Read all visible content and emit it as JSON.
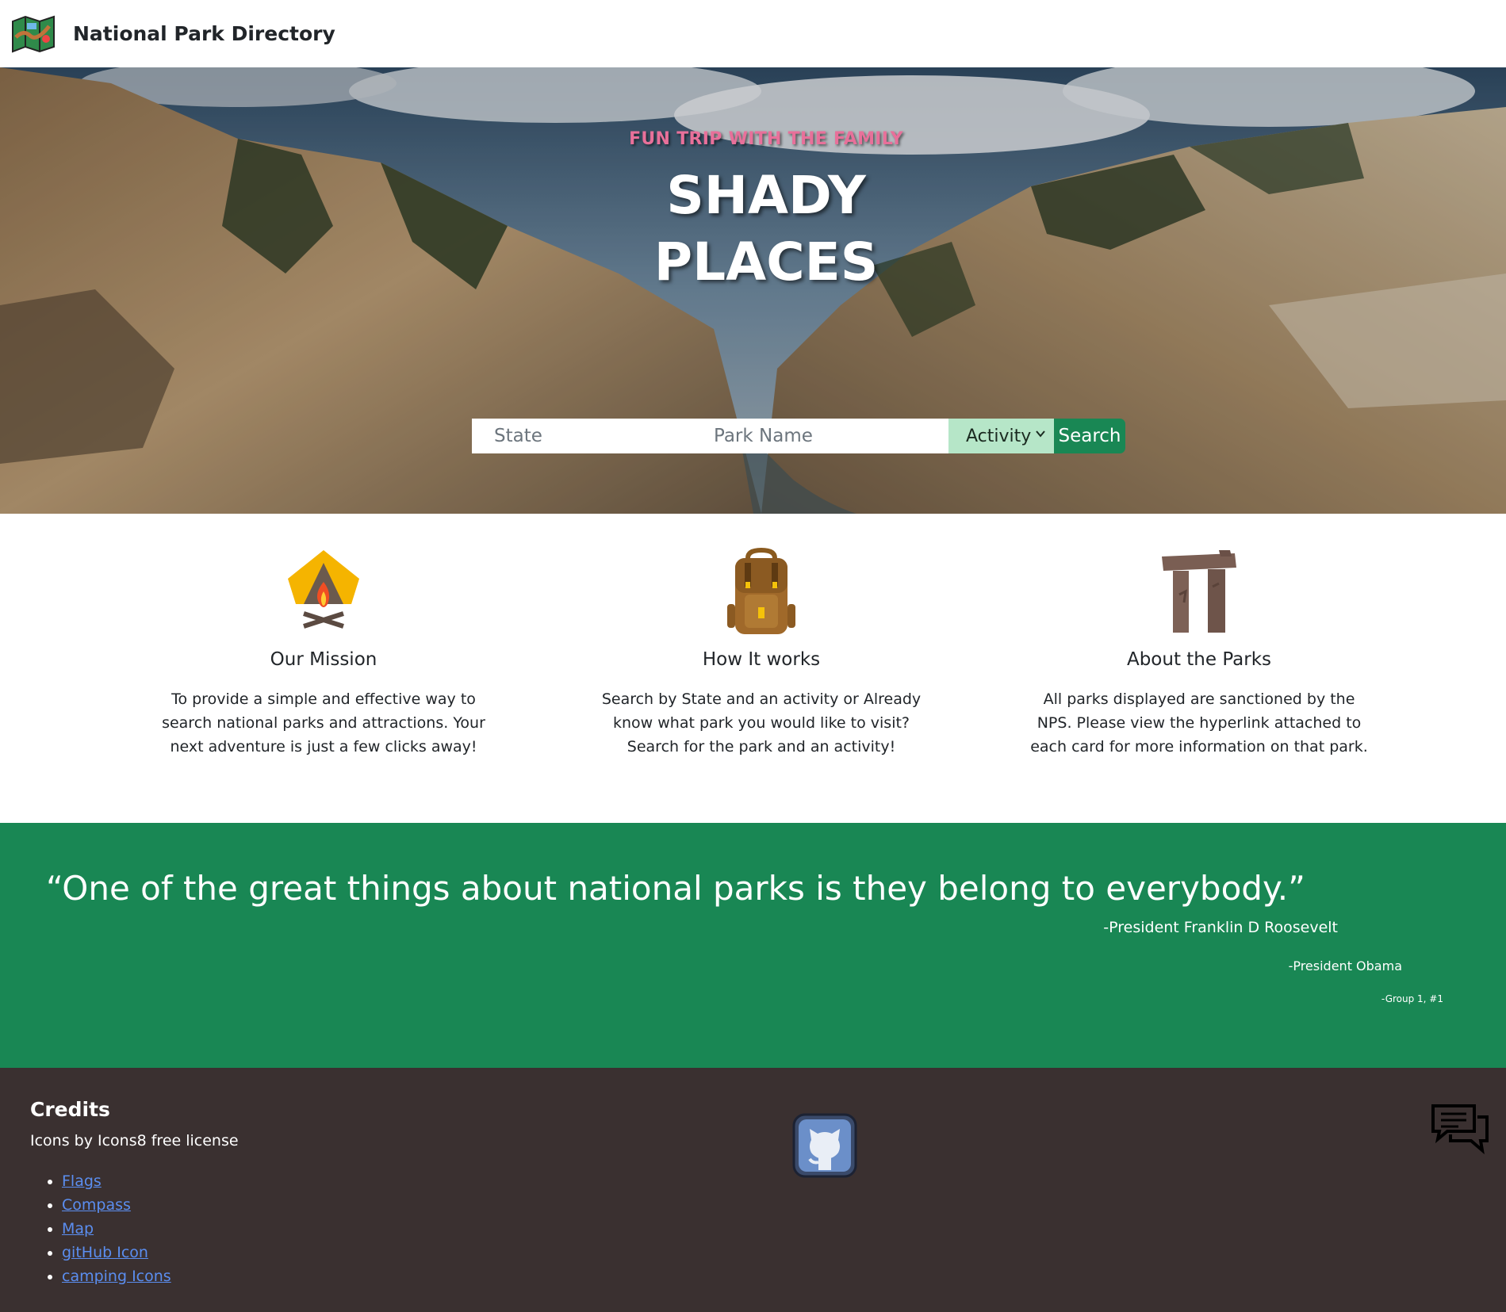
{
  "navbar": {
    "title": "National Park Directory",
    "logo_icon": "map-icon"
  },
  "hero": {
    "kicker": "FUN TRIP WITH THE FAMILY",
    "title_line1": "SHADY",
    "title_line2": "PLACES",
    "search": {
      "state_placeholder": "State",
      "park_placeholder": "Park Name",
      "activity_selected": "Activity",
      "search_label": "Search"
    }
  },
  "features": [
    {
      "icon": "campfire-tent-icon",
      "title": "Our Mission",
      "text": "To provide a simple and effective way to search national parks and attractions. Your next adventure is just a few clicks away!"
    },
    {
      "icon": "backpack-icon",
      "title": "How It works",
      "text": "Search by State and an activity or Already know what park you would like to visit? Search for the park and an activity!"
    },
    {
      "icon": "stonehenge-icon",
      "title": "About the Parks",
      "text": "All parks displayed are sanctioned by the NPS. Please view the hyperlink attached to each card for more information on that park."
    }
  ],
  "quote": {
    "text": "“One of the great things about national parks is they belong to everybody.”",
    "attribution1": "-President Franklin D Roosevelt",
    "attribution2": "-President Obama",
    "attribution3": "-Group 1, #1"
  },
  "footer": {
    "credits_title": "Credits",
    "credits_sub": "Icons by Icons8 free license",
    "links": [
      "Flags",
      "Compass",
      "Map",
      "gitHub Icon",
      "camping Icons"
    ],
    "github_icon": "github-icon",
    "chat_icon": "chat-icon"
  },
  "colors": {
    "accent_green": "#198754",
    "select_green": "#b6e6c8",
    "footer_bg": "#3a3030",
    "kicker_pink": "#e8709a",
    "link_blue": "#5b8ef0"
  }
}
